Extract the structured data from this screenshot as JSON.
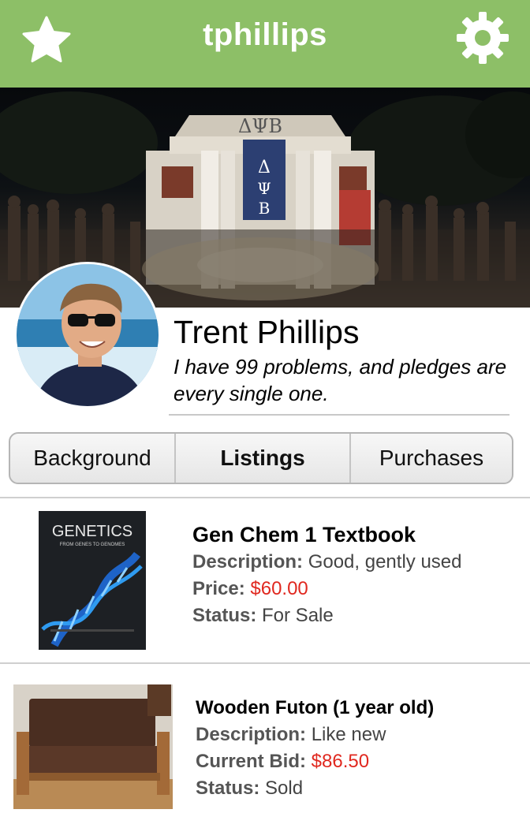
{
  "header": {
    "username": "tphillips",
    "left_icon": "star-icon",
    "right_icon": "gear-icon",
    "color": "#8dbf67"
  },
  "cover": {
    "description_icon": "cover-photo"
  },
  "profile": {
    "name": "Trent Phillips",
    "bio": "I have 99 problems, and pledges are every single one."
  },
  "tabs": [
    {
      "label": "Background",
      "active": false
    },
    {
      "label": "Listings",
      "active": true
    },
    {
      "label": "Purchases",
      "active": false
    }
  ],
  "listings": [
    {
      "title": "Gen Chem 1 Textbook",
      "rows": [
        {
          "key": "Description:",
          "value": "Good, gently used"
        },
        {
          "key": "Price:",
          "value": "$60.00"
        },
        {
          "key": "Status:",
          "value": "For Sale"
        }
      ],
      "cover_title": "GENETICS",
      "cover_subtitle": "FROM GENES TO GENOMES"
    },
    {
      "title": "Wooden Futon (1 year old)",
      "rows": [
        {
          "key": "Description:",
          "value": "Like new"
        },
        {
          "key": "Current Bid:",
          "value": "$86.50"
        },
        {
          "key": "Status:",
          "value": "Sold"
        }
      ]
    }
  ],
  "colors": {
    "price": "#e0281f",
    "label": "#555555"
  }
}
